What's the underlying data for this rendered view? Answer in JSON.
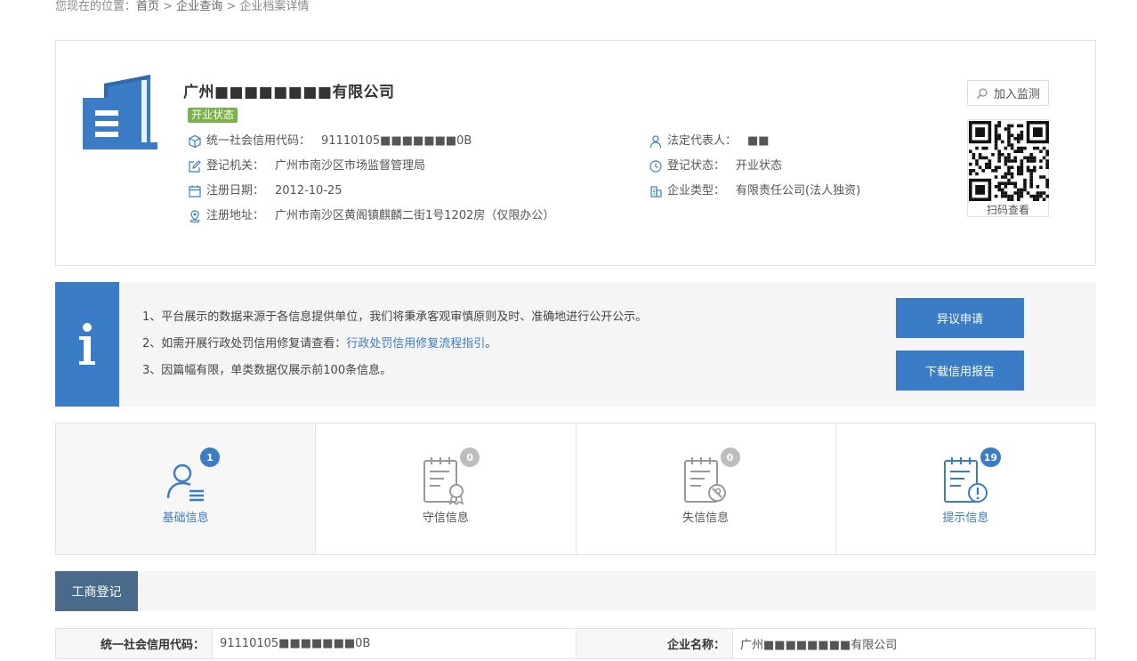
{
  "breadcrumb": {
    "prefix": "您现在的位置：",
    "home": "首页",
    "sep": " > ",
    "search": "企业查询",
    "current": "企业档案详情"
  },
  "company": {
    "name": "广州■■■■■■■■有限公司",
    "status_tag": "开业状态",
    "fields": {
      "credit_code": {
        "label": "统一社会信用代码：",
        "value": "91110105■■■■■■■0B"
      },
      "authority": {
        "label": "登记机关：",
        "value": "广州市南沙区市场监督管理局"
      },
      "reg_date": {
        "label": "注册日期：",
        "value": "2012-10-25"
      },
      "address": {
        "label": "注册地址：",
        "value": "广州市南沙区黄阁镇麒麟二街1号1202房（仅限办公）"
      },
      "legal_rep": {
        "label": "法定代表人：",
        "value": "■■"
      },
      "reg_status": {
        "label": "登记状态：",
        "value": "开业状态"
      },
      "company_type": {
        "label": "企业类型：",
        "value": "有限责任公司(法人独资)"
      }
    },
    "monitor_label": "加入监测",
    "qr_caption": "扫码查看"
  },
  "notice": {
    "line1": "1、平台展示的数据来源于各信息提供单位，我们将秉承客观审慎原则及时、准确地进行公开公示。",
    "line2_prefix": "2、如需开展行政处罚信用修复请查看：",
    "line2_link": "行政处罚信用修复流程指引",
    "line2_suffix": "。",
    "line3": "3、因篇幅有限，单类数据仅展示前100条信息。",
    "btn_objection": "异议申请",
    "btn_download": "下载信用报告"
  },
  "tabs": [
    {
      "label": "基础信息",
      "count": "1",
      "color": "#3a7cc5"
    },
    {
      "label": "守信信息",
      "count": "0",
      "color": "#555555"
    },
    {
      "label": "失信信息",
      "count": "0",
      "color": "#555555"
    },
    {
      "label": "提示信息",
      "count": "19",
      "color": "#3a7cc5"
    }
  ],
  "section": {
    "title": "工商登记"
  },
  "reg_table": {
    "credit_code_label": "统一社会信用代码：",
    "credit_code_value": "91110105■■■■■■■0B",
    "name_label": "企业名称：",
    "name_value": "广州■■■■■■■■有限公司"
  },
  "colors": {
    "primary": "#3a7cc5",
    "status_green": "#7bb34a",
    "section_dark": "#4a6a8c"
  }
}
